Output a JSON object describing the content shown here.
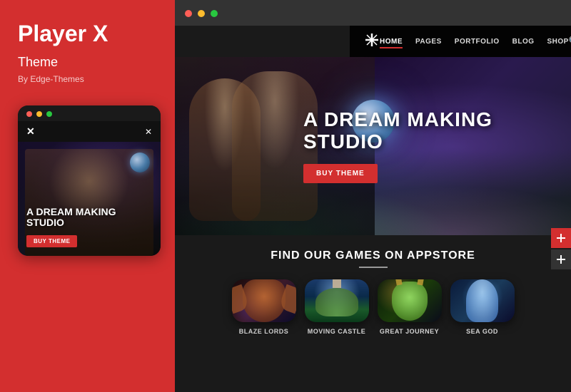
{
  "left_panel": {
    "title_line1": "Player X",
    "title_line2": "Theme",
    "by_text": "By Edge-Themes",
    "mobile_preview": {
      "dots": [
        "red",
        "yellow",
        "green"
      ],
      "hero_title": "A DREAM MAKING STUDIO",
      "buy_button": "BUY THEME"
    }
  },
  "right_panel": {
    "browser_dots": [
      "red",
      "yellow",
      "green"
    ],
    "site_nav": {
      "logo_icon": "✕",
      "links": [
        {
          "label": "HOME",
          "active": true
        },
        {
          "label": "PAGES",
          "active": false
        },
        {
          "label": "PORTFOLIO",
          "active": false
        },
        {
          "label": "BLOG",
          "active": false
        },
        {
          "label": "SHOP",
          "active": false
        }
      ]
    },
    "hero": {
      "title": "A DREAM MAKING STUDIO",
      "cta_button": "BUY THEME"
    },
    "games_section": {
      "title": "FIND OUR GAMES ON APPSTORE",
      "games": [
        {
          "name": "BLAZE LORDS",
          "theme": "blaze"
        },
        {
          "name": "MOVING CASTLE",
          "theme": "castle"
        },
        {
          "name": "GREAT JOURNEY",
          "theme": "journey"
        },
        {
          "name": "SEA GOD",
          "theme": "seagod"
        }
      ]
    }
  }
}
